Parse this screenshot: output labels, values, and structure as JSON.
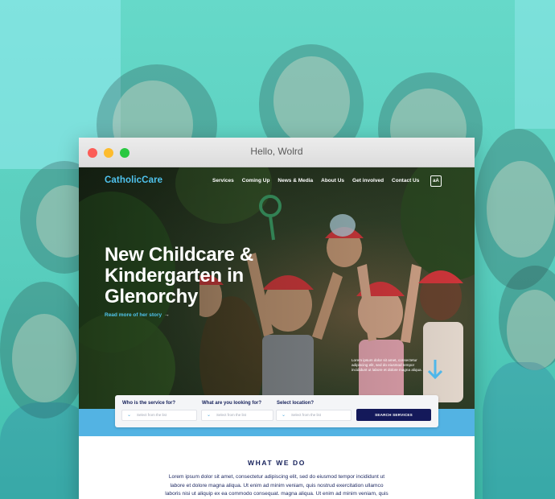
{
  "window": {
    "title": "Hello, Wolrd"
  },
  "site": {
    "logo": "CatholicCare",
    "nav": [
      "Services",
      "Coming Up",
      "News & Media",
      "About Us",
      "Get involved",
      "Contact Us"
    ],
    "text_size_button": "aA"
  },
  "hero": {
    "headline_lines": [
      "New Childcare &",
      "Kindergarten in",
      "Glenorchy"
    ],
    "read_more": "Read more of her story",
    "blurb": "Lorem ipsum dolor sit amet, consectetur adipiscing elit, sed do eiusmod tempor incididunt ut labore et dolore magna aliqua."
  },
  "search": {
    "fields": [
      {
        "label": "Who is the service for?",
        "placeholder": "Select from the list"
      },
      {
        "label": "What are you looking for?",
        "placeholder": "Select from the list"
      },
      {
        "label": "Select location?",
        "placeholder": "Select from the list"
      }
    ],
    "button": "SEARCH SERVICES"
  },
  "what_we_do": {
    "title": "WHAT WE DO",
    "body": "Lorem ipsum dolor sit amet, consectetur adipiscing elit, sed do eiusmod tempor incididunt ut labore et dolore magna aliqua. Ut enim ad minim veniam, quis nostrud exercitation ullamco laboris nisi ut aliquip ex ea commodo consequat.  magna aliqua. Ut enim ad minim veniam, quis"
  },
  "colors": {
    "background_teal": "#5fd3c4",
    "brand_blue": "#4fc3ee",
    "band_blue": "#53b3e3",
    "navy": "#14195a"
  }
}
